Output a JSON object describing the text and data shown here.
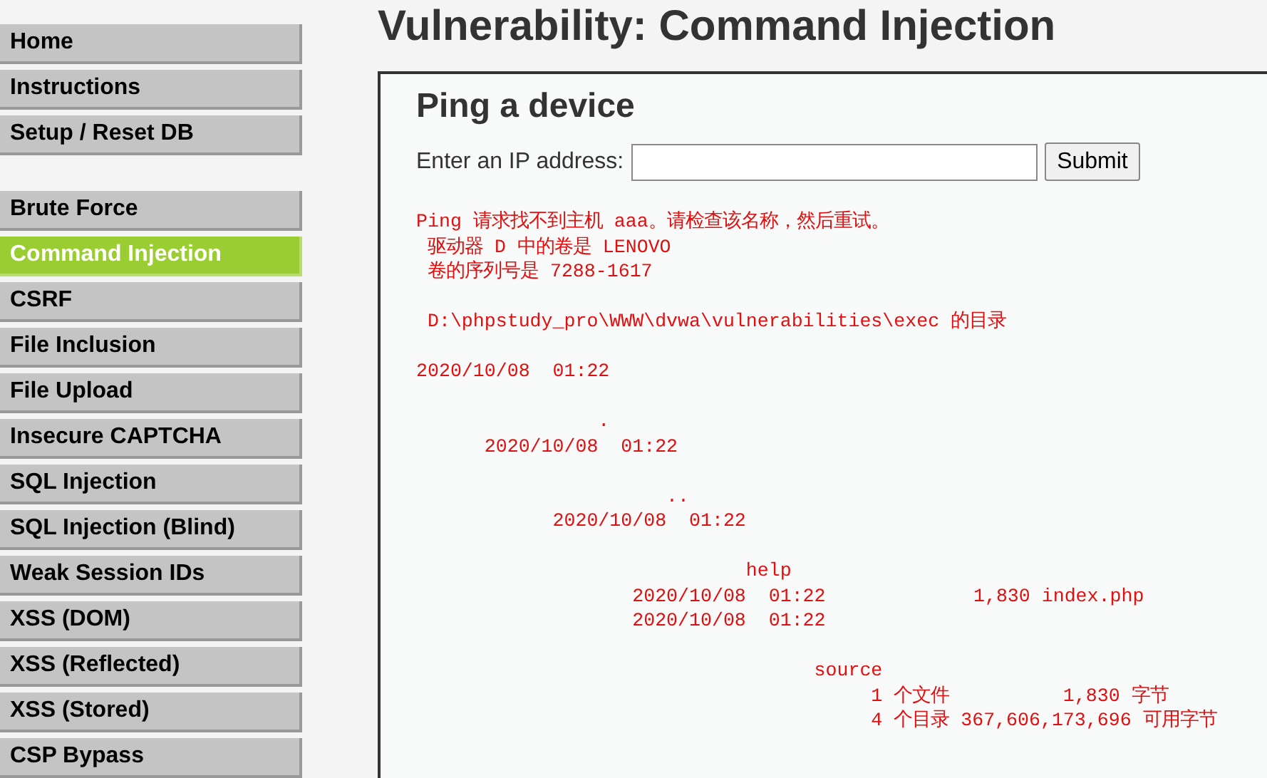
{
  "sidebar": {
    "groups": [
      {
        "items": [
          {
            "label": "Home",
            "selected": false
          },
          {
            "label": "Instructions",
            "selected": false
          },
          {
            "label": "Setup / Reset DB",
            "selected": false
          }
        ]
      },
      {
        "items": [
          {
            "label": "Brute Force",
            "selected": false
          },
          {
            "label": "Command Injection",
            "selected": true
          },
          {
            "label": "CSRF",
            "selected": false
          },
          {
            "label": "File Inclusion",
            "selected": false
          },
          {
            "label": "File Upload",
            "selected": false
          },
          {
            "label": "Insecure CAPTCHA",
            "selected": false
          },
          {
            "label": "SQL Injection",
            "selected": false
          },
          {
            "label": "SQL Injection (Blind)",
            "selected": false
          },
          {
            "label": "Weak Session IDs",
            "selected": false
          },
          {
            "label": "XSS (DOM)",
            "selected": false
          },
          {
            "label": "XSS (Reflected)",
            "selected": false
          },
          {
            "label": "XSS (Stored)",
            "selected": false
          },
          {
            "label": "CSP Bypass",
            "selected": false
          }
        ]
      }
    ]
  },
  "page_title": "Vulnerability: Command Injection",
  "section_title": "Ping a device",
  "form": {
    "label": "Enter an IP address:",
    "button": "Submit"
  },
  "output_paragraphs": [
    [
      "Ping 请求找不到主机 aaa。请检查该名称，然后重试。",
      " 驱动器 D 中的卷是 LENOVO",
      " 卷的序列号是 7288-1617"
    ],
    [
      " D:\\phpstudy_pro\\WWW\\dvwa\\vulnerabilities\\exec 的目录"
    ],
    [
      "2020/10/08  01:22"
    ],
    [
      "                .",
      "      2020/10/08  01:22"
    ],
    [
      "                      ..",
      "            2020/10/08  01:22"
    ],
    [
      "                             help",
      "                   2020/10/08  01:22             1,830 index.php",
      "                   2020/10/08  01:22"
    ],
    [
      "                                   source",
      "                                        1 个文件          1,830 字节",
      "                                        4 个目录 367,606,173,696 可用字节"
    ]
  ]
}
